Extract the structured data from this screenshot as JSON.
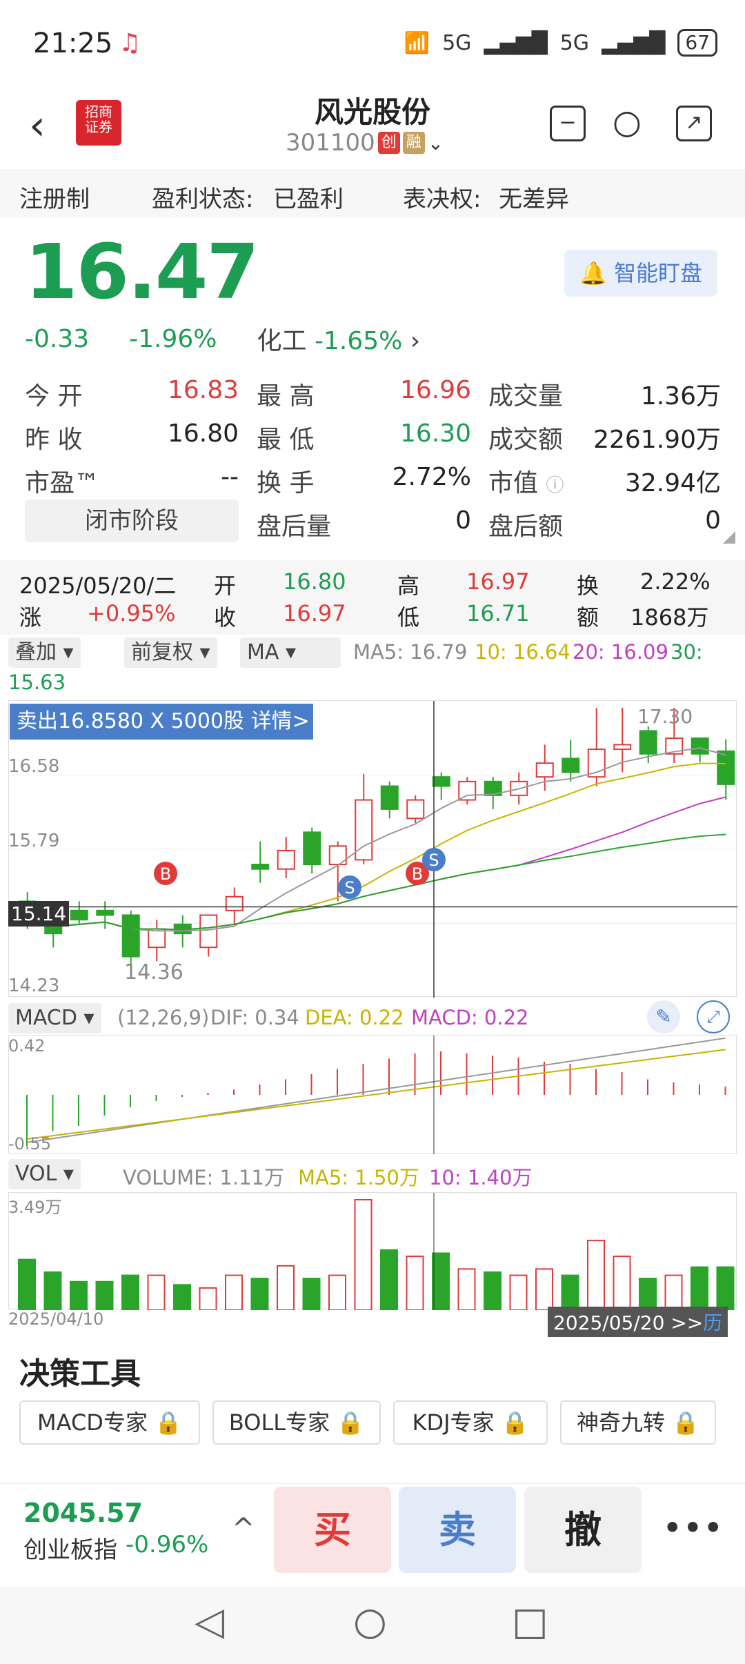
{
  "status": {
    "time": "21:25",
    "battery": "67",
    "net1": "5G",
    "net2": "5G"
  },
  "header": {
    "title": "风光股份",
    "code": "301100",
    "tag1": "创",
    "tag2": "融",
    "logo": "招商证券"
  },
  "info": {
    "reg": "注册制",
    "profit_label": "盈利状态:",
    "profit": "已盈利",
    "vote_label": "表决权:",
    "vote": "无差异"
  },
  "price": {
    "last": "16.47",
    "change": "-0.33",
    "pct": "-1.96%",
    "industry": "化工",
    "industry_pct": "-1.65%",
    "alert": "智能盯盘"
  },
  "stats": {
    "open_l": "今  开",
    "open": "16.83",
    "high_l": "最  高",
    "high": "16.96",
    "vol_l": "成交量",
    "vol": "1.36万",
    "prev_l": "昨  收",
    "prev": "16.80",
    "low_l": "最  低",
    "low": "16.30",
    "amt_l": "成交额",
    "amt": "2261.90万",
    "pe_l": "市盈™",
    "pe": "--",
    "turn_l": "换  手",
    "turn": "2.72%",
    "mcap_l": "市值",
    "mcap": "32.94亿",
    "closed": "闭市阶段",
    "after_vol_l": "盘后量",
    "after_vol": "0",
    "after_amt_l": "盘后额",
    "after_amt": "0"
  },
  "kinfo": {
    "date": "2025/05/20/二",
    "open_l": "开",
    "open": "16.80",
    "high_l": "高",
    "high": "16.97",
    "turn_l": "换",
    "turn": "2.22%",
    "chg_l": "涨",
    "chg": "+0.95%",
    "close_l": "收",
    "close": "16.97",
    "low_l": "低",
    "low": "16.71",
    "amt_l": "额",
    "amt": "1868万"
  },
  "controls": {
    "overlay": "叠加",
    "adjust": "前复权",
    "ind": "MA",
    "ma5": "MA5: 16.79",
    "ma10": "10: 16.64",
    "ma20": "20: 16.09",
    "ma30": "30:",
    "ma30v": "15.63"
  },
  "chart": {
    "banner": "卖出16.8580 X 5000股 详情>",
    "y1": "17.30",
    "y2": "16.58",
    "y3": "15.79",
    "y4": "15.14",
    "y5": "14.23",
    "low": "14.36"
  },
  "macd": {
    "name": "MACD",
    "params": "(12,26,9)",
    "dif": "DIF: 0.34",
    "dea": "DEA: 0.22",
    "macd": "MACD: 0.22",
    "top": "0.42",
    "bot": "-0.55"
  },
  "vol": {
    "name": "VOL",
    "volume": "VOLUME: 1.11万",
    "ma5": "MA5: 1.50万",
    "ma10": "10: 1.40万",
    "top": "3.49万",
    "start": "2025/04/10",
    "end": "2025/05/20 >>",
    "hist": "历"
  },
  "tools": {
    "title": "决策工具",
    "t1": "MACD专家",
    "t2": "BOLL专家",
    "t3": "KDJ专家",
    "t4": "神奇九转"
  },
  "bottom": {
    "index_val": "2045.57",
    "index_name": "创业板指",
    "index_pct": "-0.96%",
    "buy": "买",
    "sell": "卖",
    "cancel": "撤"
  },
  "chart_data": {
    "type": "candlestick",
    "ohlc": [
      [
        15.2,
        15.3,
        14.9,
        15.0
      ],
      [
        14.95,
        15.05,
        14.7,
        14.85
      ],
      [
        15.1,
        15.2,
        14.95,
        15.0
      ],
      [
        15.1,
        15.2,
        14.9,
        15.05
      ],
      [
        15.05,
        15.1,
        14.4,
        14.6
      ],
      [
        14.7,
        15.0,
        14.55,
        14.9
      ],
      [
        14.95,
        15.05,
        14.7,
        14.85
      ],
      [
        14.7,
        15.05,
        14.6,
        15.05
      ],
      [
        15.1,
        15.35,
        14.95,
        15.25
      ],
      [
        15.6,
        15.85,
        15.4,
        15.55
      ],
      [
        15.55,
        15.9,
        15.45,
        15.75
      ],
      [
        15.95,
        16.0,
        15.5,
        15.6
      ],
      [
        15.6,
        15.85,
        15.2,
        15.8
      ],
      [
        15.65,
        16.58,
        15.6,
        16.3
      ],
      [
        16.45,
        16.5,
        16.1,
        16.2
      ],
      [
        16.1,
        16.35,
        16.05,
        16.3
      ],
      [
        16.55,
        16.6,
        16.3,
        16.45
      ],
      [
        16.3,
        16.55,
        16.25,
        16.5
      ],
      [
        16.5,
        16.55,
        16.2,
        16.35
      ],
      [
        16.35,
        16.6,
        16.25,
        16.5
      ],
      [
        16.55,
        16.9,
        16.4,
        16.7
      ],
      [
        16.75,
        16.95,
        16.5,
        16.6
      ],
      [
        16.55,
        17.3,
        16.45,
        16.85
      ],
      [
        16.85,
        17.3,
        16.6,
        16.9
      ],
      [
        17.05,
        17.1,
        16.7,
        16.8
      ],
      [
        16.8,
        17.3,
        16.7,
        16.97
      ],
      [
        16.97,
        16.97,
        16.71,
        16.8
      ],
      [
        16.83,
        16.96,
        16.3,
        16.47
      ]
    ],
    "ylim": [
      14.23,
      17.3
    ]
  }
}
